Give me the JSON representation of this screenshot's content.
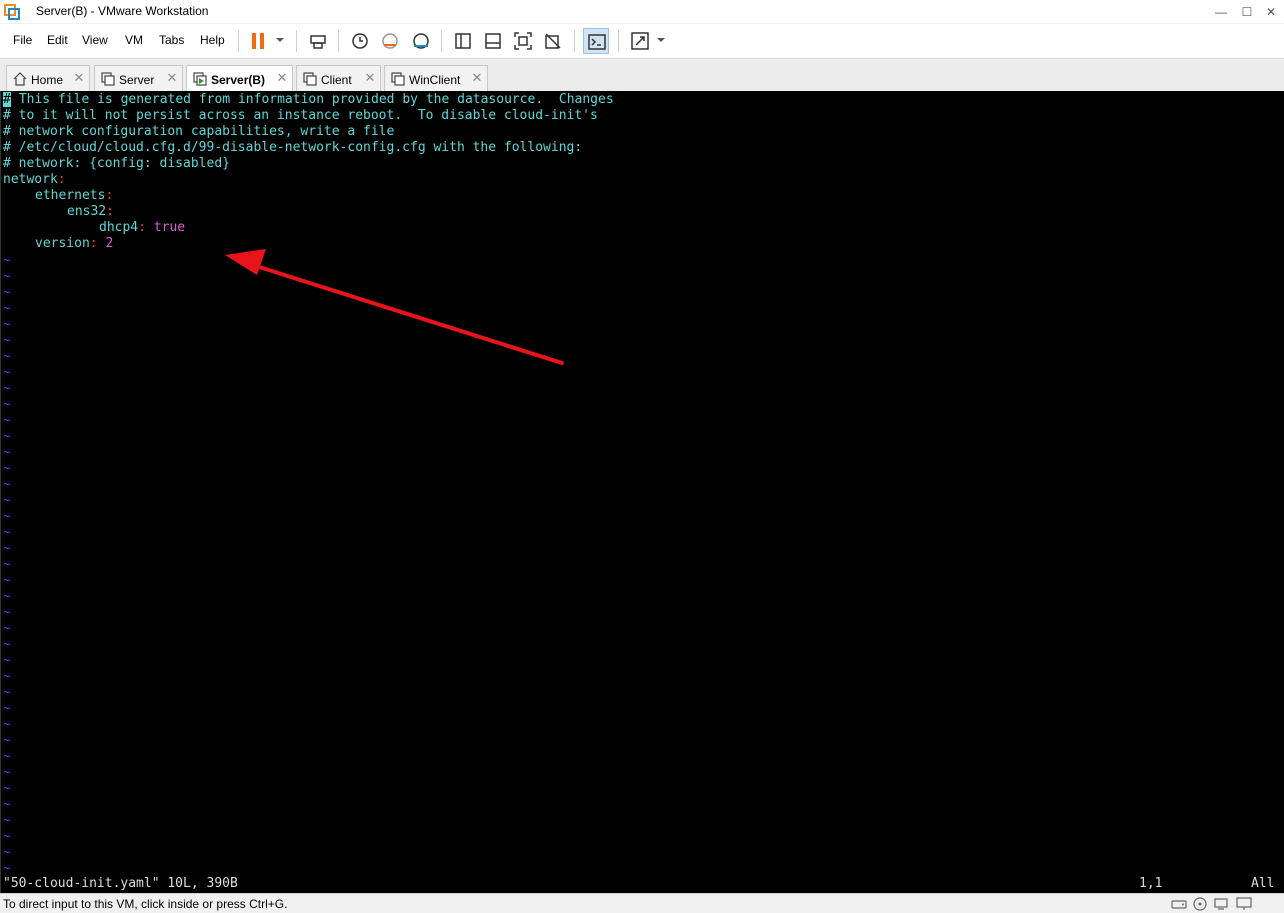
{
  "window": {
    "title": "Server(B) - VMware Workstation",
    "minimize_glyph": "—",
    "maximize_glyph": "☐",
    "close_glyph": "✕"
  },
  "menu": {
    "items": [
      "File",
      "Edit",
      "View",
      "VM",
      "Tabs",
      "Help"
    ]
  },
  "toolbar": {
    "icons": [
      "pause-icon",
      "send-ctrl-alt-del-icon",
      "snapshot-icon",
      "revert-snapshot-icon",
      "snapshot-manager-icon",
      "show-library-icon",
      "thumbnail-bar-icon",
      "full-screen-icon",
      "unity-icon",
      "console-view-icon",
      "stretch-guest-icon"
    ]
  },
  "tabs": [
    {
      "label": "Home",
      "icon": "home-icon",
      "active": false
    },
    {
      "label": "Server",
      "icon": "vm-icon",
      "active": false
    },
    {
      "label": "Server(B)",
      "icon": "vm-running-icon",
      "active": true
    },
    {
      "label": "Client",
      "icon": "vm-icon",
      "active": false
    },
    {
      "label": "WinClient",
      "icon": "vm-icon",
      "active": false
    }
  ],
  "console": {
    "comment_lines": [
      " This file is generated from information provided by the datasource.  Changes",
      "# to it will not persist across an instance reboot.  To disable cloud-init's",
      "# network configuration capabilities, write a file",
      "# /etc/cloud/cloud.cfg.d/99-disable-network-config.cfg with the following:",
      "# network: {config: disabled}"
    ],
    "cursor_char": "#",
    "yaml": {
      "network_key": "network",
      "ethernets_key": "ethernets",
      "interface_key": "ens32",
      "dhcp4_key": "dhcp4",
      "dhcp4_value": "true",
      "version_key": "version",
      "version_value": "2"
    },
    "colon": ":",
    "tilde": "~",
    "status_file": "\"50-cloud-init.yaml\" 10L, 390B",
    "cursor_position": "1,1",
    "scroll_position": "All",
    "colors": {
      "background": "#000000",
      "comment": "#5fd7d7",
      "colon": "#e64040",
      "value": "#d75fd7",
      "tilde": "#3b5fe0",
      "annotation_arrow": "#e8141a"
    }
  },
  "statusbar": {
    "hint": "To direct input to this VM, click inside or press Ctrl+G.",
    "icons": [
      "hard-disk-icon",
      "cd-rom-icon",
      "network-icon",
      "display-icon"
    ]
  }
}
